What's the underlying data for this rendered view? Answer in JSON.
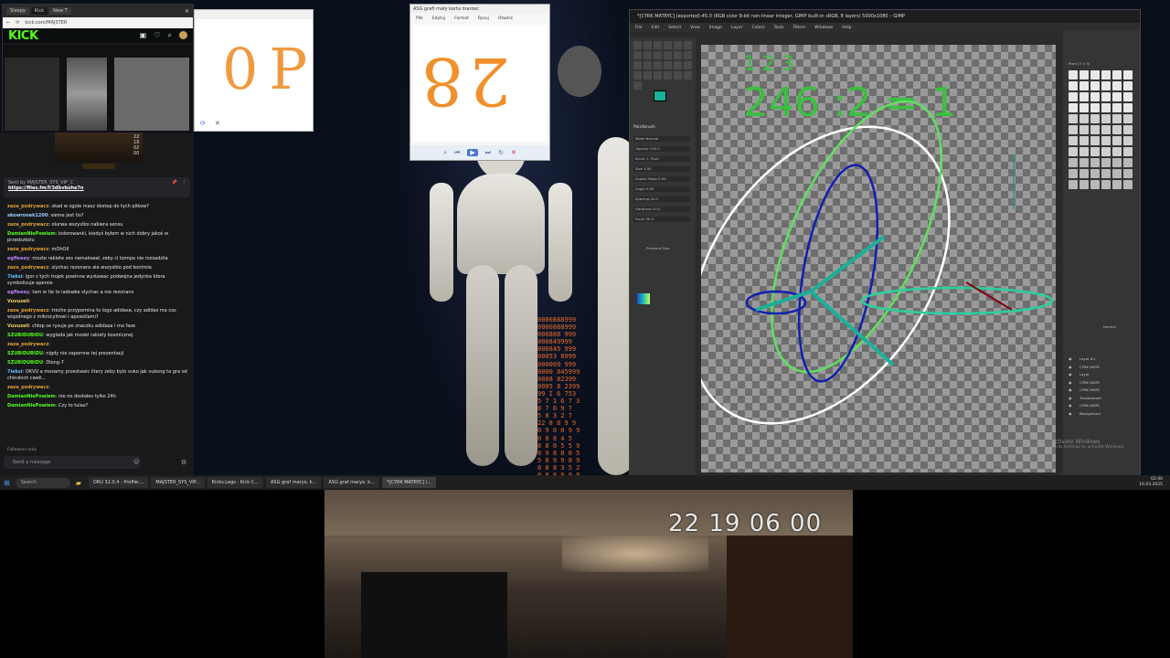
{
  "browser": {
    "tabs": [
      "Sleepy",
      "Kick",
      "New T"
    ],
    "url": "kick.com/MAJSTER",
    "logo": "KICK"
  },
  "preview_window": {
    "digits": "0P"
  },
  "paint_window": {
    "title": "ASG grafi mały karta marzec",
    "menu": [
      "Plik",
      "Edytuj",
      "Format",
      "Rysuj",
      "Otwórz"
    ],
    "digits": "28"
  },
  "chat": {
    "timecode": "22 19 02 00",
    "pinned_by": "Sent by MAJSTER_SYS_VIP_C",
    "pinned_link": "https://files.fm/f/3dbvbuhe7n",
    "messages": [
      {
        "user": "zaza_podrywacz",
        "color": "#e0a030",
        "text": "skad w ogole masz dostep do tych plikow?"
      },
      {
        "user": "skowronek1200",
        "color": "#9bd0ff",
        "text": "sieme jest tis?"
      },
      {
        "user": "zaza_podrywacz",
        "color": "#e0a030",
        "text": "olurwa wszystko nabiera sensu"
      },
      {
        "user": "DamianNiePowiem",
        "color": "#53fc18",
        "text": "kolorowanki, kiedyś byłem w nich dobry jakoś w przedszkolu"
      },
      {
        "user": "zaza_podrywacz",
        "color": "#e0a030",
        "text": "mOhOII"
      },
      {
        "user": "egfleeey",
        "color": "#c080ff",
        "text": "mozte rakiete zes namalował, zeby ci kompa nie rozsadzila"
      },
      {
        "user": "zaza_podrywacz",
        "color": "#e0a030",
        "text": "slychac rezonans ale wszystko pod kontrola"
      },
      {
        "user": "7ieksi",
        "color": "#60c0ff",
        "text": "igor z tych trojek powinna wystawac podwojna jedynka ktora symbolizuje apersie"
      },
      {
        "user": "egfleeey",
        "color": "#c080ff",
        "text": "tam w tle to ladowke slychac a nie rezonans"
      },
      {
        "user": "Vuvuzeli",
        "color": "#f0d060",
        "text": ""
      },
      {
        "user": "zaza_podrywacz",
        "color": "#e0a030",
        "text": "troche przypomina to logo adidasa, czy adidas ma cos wspolnego z mikrocyfrowi i aposotlami?"
      },
      {
        "user": "Vuvuzeli",
        "color": "#f0d060",
        "text": "chłop se rysuje po znaczku adidasa i ma faze"
      },
      {
        "user": "SZUBIDUBIDU",
        "color": "#53fc18",
        "text": "wyglada jak model rakiety kosmicznej"
      },
      {
        "user": "zaza_podrywacz",
        "color": "#e0a030",
        "text": ""
      },
      {
        "user": "SZUBIDUBIDU",
        "color": "#53fc18",
        "text": "nigdy nie zapomne tej prezentacji"
      },
      {
        "user": "SZUBIDUBIDU",
        "color": "#53fc18",
        "text": "Dlong-7"
      },
      {
        "user": "7ieksi",
        "color": "#60c0ff",
        "text": "OKVU a mozamy przestawic litery zeby bylo vuko jak vukong ta gra od chinskich cweli..."
      },
      {
        "user": "zaza_podrywacz",
        "color": "#e0a030",
        "text": ""
      },
      {
        "user": "DamianNiePowiem",
        "color": "#53fc18",
        "text": "nie no dostales tylko 24h"
      },
      {
        "user": "DamianNiePowiem",
        "color": "#53fc18",
        "text": "Czy to tulas?"
      }
    ],
    "followers_note": "Followers only",
    "input_placeholder": "Send a message"
  },
  "gimp": {
    "title": "*[CYRK MATRYC] (exported)-45.0 (RGB color 8-bit non-linear integer, GIMP built-in sRGB, 8 layers) 5000x1080 – GIMP",
    "menu": [
      "File",
      "Edit",
      "Select",
      "View",
      "Image",
      "Layer",
      "Colors",
      "Tools",
      "Filters",
      "Windows",
      "Help"
    ],
    "canvas_text_top": "1 2 3",
    "canvas_text_main": "246 :2 = 1",
    "tool_options_title": "Paintbrush",
    "tool_options": [
      "Mode Normal",
      "Opacity 100.0",
      "Brush 1. Pixel",
      "Size 3.00",
      "Aspect Ratio 0.00",
      "Angle 0.00",
      "Spacing 20.0",
      "Hardness 50.0",
      "Force 50.0"
    ],
    "dynamics": "Pressure Size",
    "layers": [
      "Layer #1",
      "CYRK MATR",
      "Layer",
      "CYRK MATR",
      "CYRK MATR",
      "Transformati",
      "CYRK MATR",
      "Background"
    ],
    "brush_title": "Pixel (3 × 3)",
    "layer_mode": "Normal",
    "activate_windows": "Activate Windows",
    "activate_sub": "Go to Settings to activate Windows."
  },
  "taskbar": {
    "search": "Search",
    "items": [
      "ORU 32.0.4 - Profile:...",
      "MAJSTER_SYS_VIP...",
      "Kicks.Legs - Kick C...",
      "ASG graf maryo. k...",
      "ASG graf maryo. k...",
      "*[CYRK MATRYC] i..."
    ],
    "time": "02:40",
    "date": "10.03.2025"
  },
  "webcam": {
    "timestamp": "22 19 06 00"
  },
  "wallpaper": {
    "number_rain": [
      "0000888999",
      "0000888999",
      "000888 999",
      "000849999",
      "000845 999",
      "00053 8999",
      "000009 999",
      "0000 845999",
      "0008 82399",
      "0005 8 2399",
      "99 I 6 753",
      "5 7 1 6 7 3",
      "8 7 0 9 7",
      "5 8 3 2 7",
      "22 8 8 9 9",
      "0 9 0 0 9 9",
      "0 0 8 4 5",
      "8 8 0 5 5 9",
      "0 9 8 8 0 5",
      "5 8 9 9 8 9",
      "0 8 8 3 5 2",
      "0 8 8 8 9 9",
      "8 0 8 8 9 9"
    ]
  }
}
